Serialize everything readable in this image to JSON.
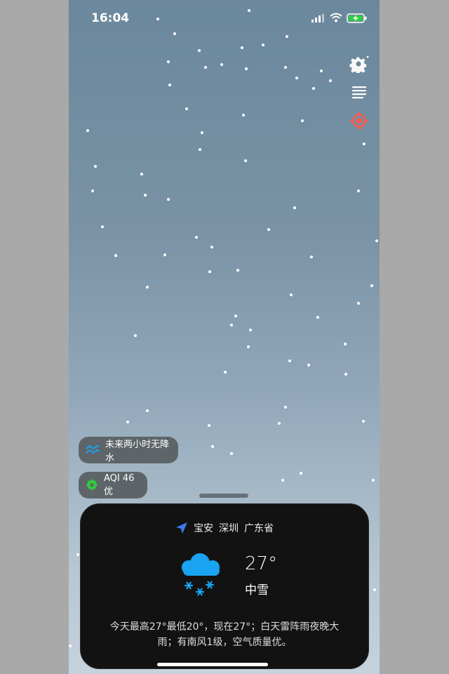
{
  "status_bar": {
    "time": "16:04"
  },
  "sidebar": {
    "icons": [
      "gear-icon",
      "list-icon",
      "crosshair-icon"
    ]
  },
  "chips": {
    "rain": {
      "text": "未来两小时无降水",
      "icon": "wave-icon"
    },
    "aqi": {
      "text": "AQI 46 优",
      "icon": "gear-icon",
      "color": "#2ecc40"
    }
  },
  "card": {
    "location": {
      "district": "宝安",
      "city": "深圳",
      "province": "广东省"
    },
    "temperature": "27°",
    "condition": "中雪",
    "summary": "今天最高27°最低20°，现在27°；白天雷阵雨夜晚大雨；有南风1级，空气质量优。"
  },
  "colors": {
    "accent_blue": "#1aa3f0",
    "location_arrow": "#3c7bf0",
    "locate_red": "#ff5a4c",
    "battery_green": "#2ecc40"
  }
}
